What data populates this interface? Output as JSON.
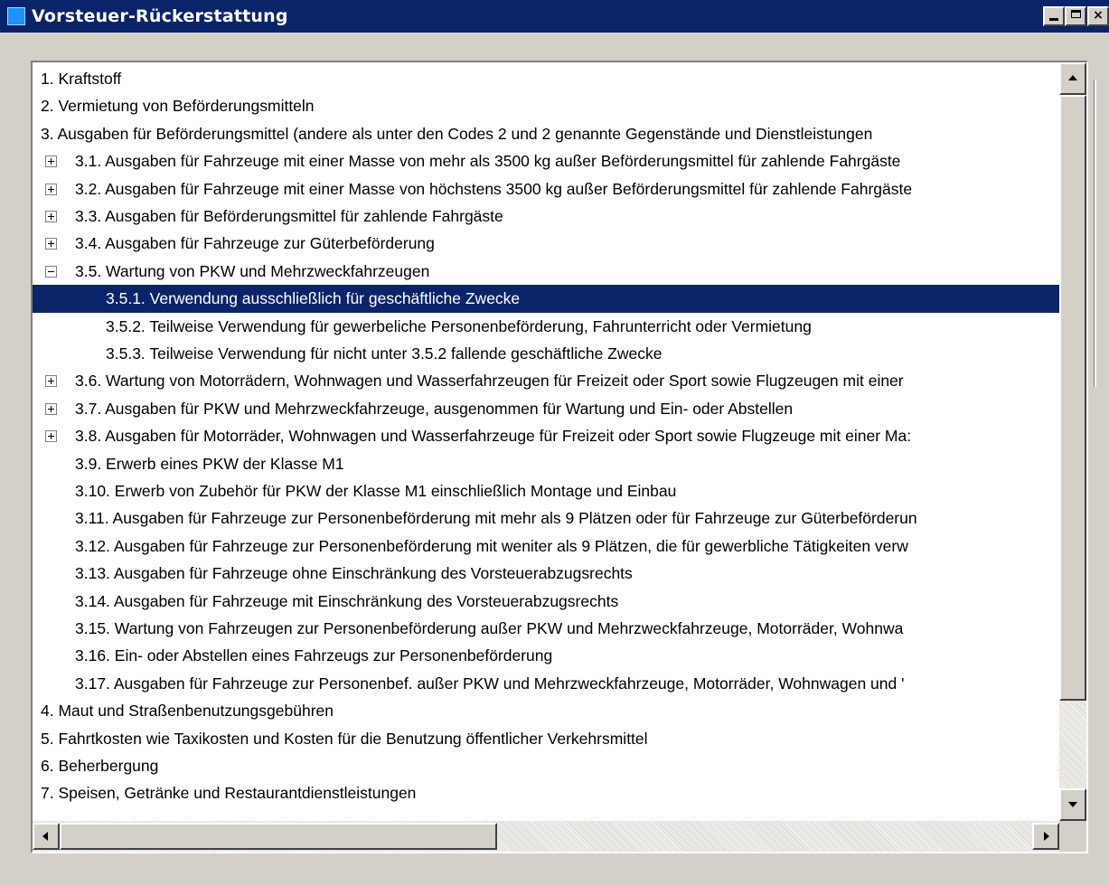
{
  "window": {
    "title": "Vorsteuer-Rückerstattung",
    "controls": {
      "minimize": "_",
      "maximize": "□",
      "close": "×"
    }
  },
  "tree": {
    "items": [
      {
        "label": "1. Kraftstoff",
        "level": 0,
        "expander": "none"
      },
      {
        "label": "2. Vermietung von Beförderungsmitteln",
        "level": 0,
        "expander": "none"
      },
      {
        "label": "3. Ausgaben für Beförderungsmittel (andere als unter den Codes 2 und 2 genannte Gegenstände und Dienstleistungen",
        "level": 0,
        "expander": "none"
      },
      {
        "label": "3.1. Ausgaben für Fahrzeuge mit einer Masse von mehr als 3500 kg außer Beförderungsmittel für zahlende Fahrgäste",
        "level": 1,
        "expander": "plus"
      },
      {
        "label": "3.2. Ausgaben für Fahrzeuge mit einer Masse von höchstens 3500 kg außer Beförderungsmittel für zahlende Fahrgäste",
        "level": 1,
        "expander": "plus"
      },
      {
        "label": "3.3. Ausgaben für Beförderungsmittel für zahlende Fahrgäste",
        "level": 1,
        "expander": "plus"
      },
      {
        "label": "3.4. Ausgaben für Fahrzeuge zur Güterbeförderung",
        "level": 1,
        "expander": "plus"
      },
      {
        "label": "3.5. Wartung von PKW und Mehrzweckfahrzeugen",
        "level": 1,
        "expander": "minus"
      },
      {
        "label": "3.5.1. Verwendung ausschließlich für geschäftliche Zwecke",
        "level": 2,
        "expander": "none",
        "selected": true
      },
      {
        "label": "3.5.2. Teilweise Verwendung für gewerbeliche Personenbeförderung, Fahrunterricht oder Vermietung",
        "level": 2,
        "expander": "none"
      },
      {
        "label": "3.5.3. Teilweise Verwendung für nicht unter 3.5.2 fallende geschäftliche Zwecke",
        "level": 2,
        "expander": "none"
      },
      {
        "label": "3.6. Wartung von Motorrädern, Wohnwagen und Wasserfahrzeugen für Freizeit oder Sport sowie Flugzeugen mit einer",
        "level": 1,
        "expander": "plus"
      },
      {
        "label": "3.7. Ausgaben für PKW und Mehrzweckfahrzeuge, ausgenommen für Wartung und Ein- oder Abstellen",
        "level": 1,
        "expander": "plus"
      },
      {
        "label": "3.8. Ausgaben für Motorräder, Wohnwagen und Wasserfahrzeuge für Freizeit oder Sport sowie Flugzeuge mit einer Ma:",
        "level": 1,
        "expander": "plus"
      },
      {
        "label": "3.9. Erwerb eines PKW der Klasse M1",
        "level": 1,
        "expander": "none"
      },
      {
        "label": "3.10. Erwerb von Zubehör für PKW der Klasse M1 einschließlich Montage und Einbau",
        "level": 1,
        "expander": "none"
      },
      {
        "label": "3.11. Ausgaben für Fahrzeuge zur Personenbeförderung mit mehr als 9 Plätzen oder für Fahrzeuge zur Güterbeförderun",
        "level": 1,
        "expander": "none"
      },
      {
        "label": "3.12. Ausgaben für Fahrzeuge zur Personenbeförderung mit weniter als 9 Plätzen, die für gewerbliche Tätigkeiten verw",
        "level": 1,
        "expander": "none"
      },
      {
        "label": "3.13. Ausgaben für Fahrzeuge ohne Einschränkung des Vorsteuerabzugsrechts",
        "level": 1,
        "expander": "none"
      },
      {
        "label": "3.14. Ausgaben für Fahrzeuge mit Einschränkung des Vorsteuerabzugsrechts",
        "level": 1,
        "expander": "none"
      },
      {
        "label": "3.15. Wartung von Fahrzeugen zur Personenbeförderung außer PKW und Mehrzweckfahrzeuge, Motorräder, Wohnwa",
        "level": 1,
        "expander": "none"
      },
      {
        "label": "3.16. Ein- oder Abstellen eines Fahrzeugs zur Personenbeförderung",
        "level": 1,
        "expander": "none"
      },
      {
        "label": "3.17. Ausgaben für Fahrzeuge zur Personenbef. außer PKW und Mehrzweckfahrzeuge, Motorräder, Wohnwagen und '",
        "level": 1,
        "expander": "none"
      },
      {
        "label": "4. Maut und Straßenbenutzungsgebühren",
        "level": 0,
        "expander": "none"
      },
      {
        "label": "5. Fahrtkosten wie Taxikosten und Kosten für die Benutzung öffentlicher Verkehrsmittel",
        "level": 0,
        "expander": "none"
      },
      {
        "label": "6. Beherbergung",
        "level": 0,
        "expander": "none"
      },
      {
        "label": "7. Speisen, Getränke und Restaurantdienstleistungen",
        "level": 0,
        "expander": "none"
      }
    ]
  },
  "colors": {
    "titlebar": "#0a246a",
    "selection": "#0a246a",
    "face": "#d4d0c8"
  }
}
